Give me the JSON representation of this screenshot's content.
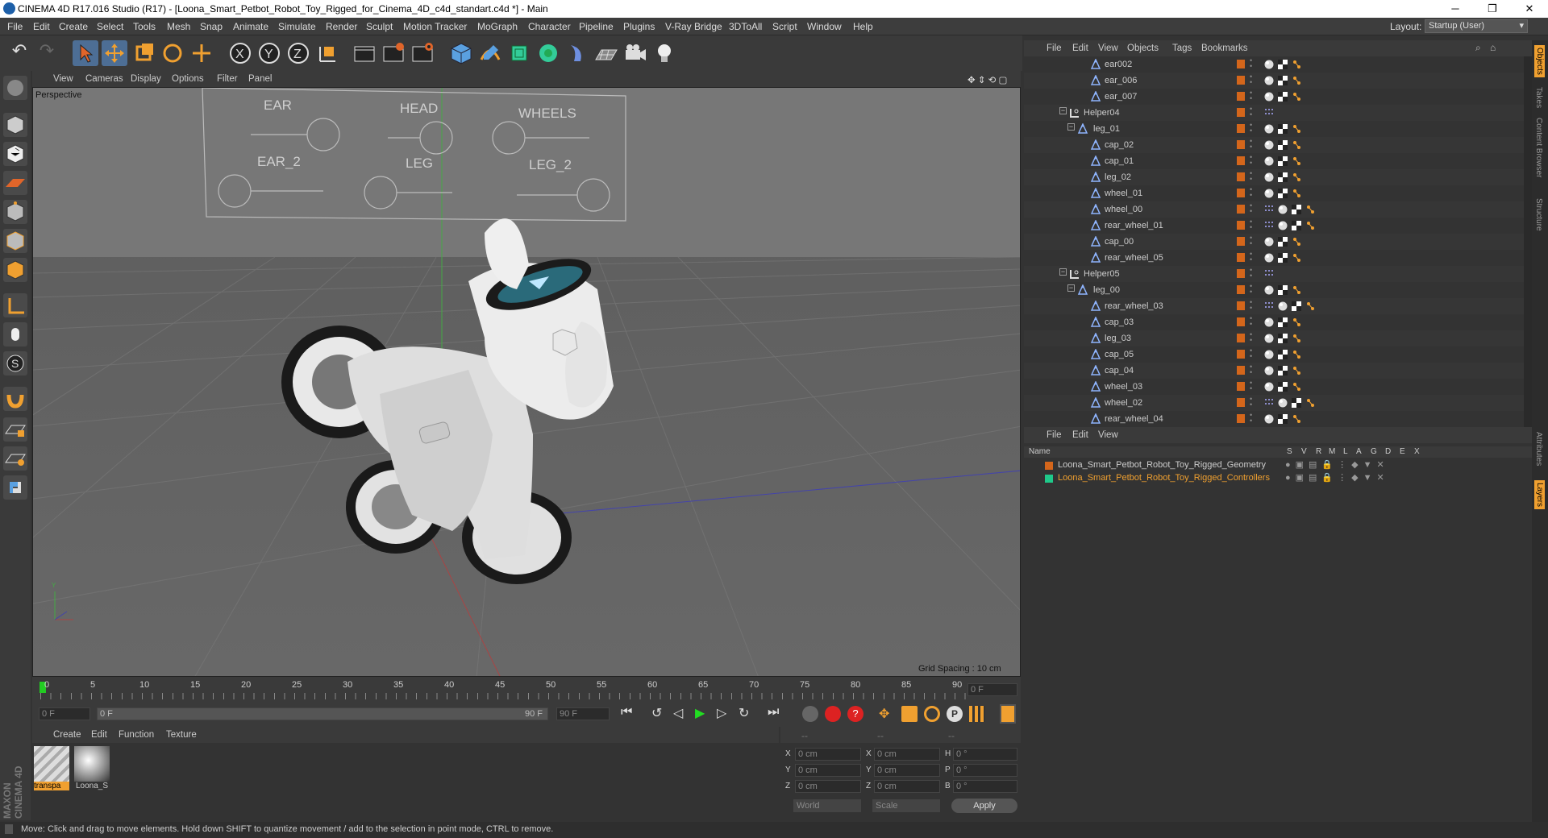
{
  "window": {
    "title": "CINEMA 4D R17.016 Studio (R17) - [Loona_Smart_Petbot_Robot_Toy_Rigged_for_Cinema_4D_c4d_standart.c4d *] - Main",
    "minimize": "─",
    "maximize": "❐",
    "close": "✕"
  },
  "menubar": {
    "items": [
      "File",
      "Edit",
      "Create",
      "Select",
      "Tools",
      "Mesh",
      "Snap",
      "Animate",
      "Simulate",
      "Render",
      "Sculpt",
      "Motion Tracker",
      "MoGraph",
      "Character",
      "Pipeline",
      "Plugins",
      "V-Ray Bridge",
      "3DToAll",
      "Script",
      "Window",
      "Help"
    ],
    "layout_label": "Layout:",
    "layout_value": "Startup (User)"
  },
  "viewport": {
    "menu": [
      "View",
      "Cameras",
      "Display",
      "Options",
      "Filter",
      "Panel"
    ],
    "camera_label": "Perspective",
    "grid_spacing": "Grid Spacing : 10 cm",
    "controls": {
      "labels": [
        "EAR",
        "HEAD",
        "WHEELS",
        "EAR_2",
        "LEG",
        "LEG_2"
      ]
    }
  },
  "timeline": {
    "ticks": [
      "0",
      "5",
      "10",
      "15",
      "20",
      "25",
      "30",
      "35",
      "40",
      "45",
      "50",
      "55",
      "60",
      "65",
      "70",
      "75",
      "80",
      "85",
      "90"
    ],
    "frame_display": "0 F"
  },
  "playbar": {
    "start": "0 F",
    "range_start": "0 F",
    "range_end": "90 F",
    "end": "90 F"
  },
  "materials": {
    "menu": [
      "Create",
      "Edit",
      "Function",
      "Texture"
    ],
    "items": [
      "transpa",
      "Loona_S"
    ]
  },
  "coords": {
    "header": [
      "--",
      "--",
      "--"
    ],
    "rows": [
      {
        "a": "X",
        "v1": "0 cm",
        "b": "X",
        "v2": "0 cm",
        "c": "H",
        "v3": "0 °"
      },
      {
        "a": "Y",
        "v1": "0 cm",
        "b": "Y",
        "v2": "0 cm",
        "c": "P",
        "v3": "0 °"
      },
      {
        "a": "Z",
        "v1": "0 cm",
        "b": "Z",
        "v2": "0 cm",
        "c": "B",
        "v3": "0 °"
      }
    ],
    "mode": "World",
    "scale": "Scale",
    "apply": "Apply"
  },
  "objects": {
    "menu": [
      "File",
      "Edit",
      "View",
      "Objects",
      "Tags",
      "Bookmarks"
    ],
    "rows": [
      {
        "name": "ear002",
        "type": "bone"
      },
      {
        "name": "ear_006",
        "type": "bone"
      },
      {
        "name": "ear_007",
        "type": "bone"
      },
      {
        "name": "Helper04",
        "type": "null"
      },
      {
        "name": "leg_01",
        "type": "bone"
      },
      {
        "name": "cap_02",
        "type": "bone"
      },
      {
        "name": "cap_01",
        "type": "bone"
      },
      {
        "name": "leg_02",
        "type": "bone"
      },
      {
        "name": "wheel_01",
        "type": "bone"
      },
      {
        "name": "wheel_00",
        "type": "bone"
      },
      {
        "name": "rear_wheel_01",
        "type": "bone"
      },
      {
        "name": "cap_00",
        "type": "bone"
      },
      {
        "name": "rear_wheel_05",
        "type": "bone"
      },
      {
        "name": "Helper05",
        "type": "null"
      },
      {
        "name": "leg_00",
        "type": "bone"
      },
      {
        "name": "rear_wheel_03",
        "type": "bone"
      },
      {
        "name": "cap_03",
        "type": "bone"
      },
      {
        "name": "leg_03",
        "type": "bone"
      },
      {
        "name": "cap_05",
        "type": "bone"
      },
      {
        "name": "cap_04",
        "type": "bone"
      },
      {
        "name": "wheel_03",
        "type": "bone"
      },
      {
        "name": "wheel_02",
        "type": "bone"
      },
      {
        "name": "rear_wheel_04",
        "type": "bone"
      }
    ]
  },
  "layers": {
    "menu": [
      "File",
      "Edit",
      "View"
    ],
    "columns": [
      "Name",
      "S",
      "V",
      "R",
      "M",
      "L",
      "A",
      "G",
      "D",
      "E",
      "X"
    ],
    "items": [
      {
        "name": "Loona_Smart_Petbot_Robot_Toy_Rigged_Geometry",
        "color": "#d4661b"
      },
      {
        "name": "Loona_Smart_Petbot_Robot_Toy_Rigged_Controllers",
        "color": "#1fc98a"
      }
    ]
  },
  "right_tabs": [
    "Objects",
    "Takes",
    "Content Browser",
    "Structure",
    "Attributes",
    "Layers"
  ],
  "status": "Move: Click and drag to move elements. Hold down SHIFT to quantize movement / add to the selection in point mode, CTRL to remove.",
  "maxon": "MAXON CINEMA 4D",
  "colors": {
    "accent": "#f0a030",
    "orange_tag": "#d4661b"
  }
}
